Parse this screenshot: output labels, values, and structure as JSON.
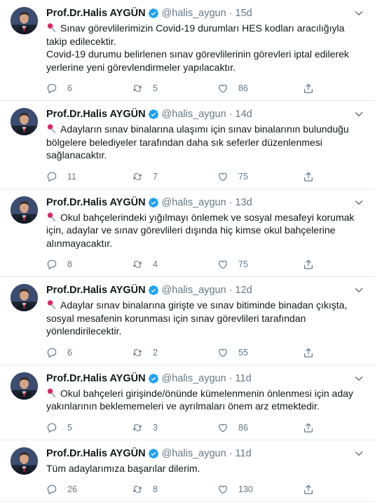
{
  "author": {
    "name": "Prof.Dr.Halis AYGÜN",
    "handle": "@halis_aygun"
  },
  "colors": {
    "text": "#14171a",
    "muted": "#657786",
    "verified": "#1da1f2",
    "divider": "#e6ecf0"
  },
  "tweets": [
    {
      "time": "15d",
      "pinned": true,
      "lines": [
        "Sınav görevlilerimizin Covid-19 durumları HES kodları aracılığıyla takip edilecektir.",
        "Covid-19 durumu belirlenen sınav görevlilerinin görevleri iptal edilerek yerlerine yeni görevlendirmeler yapılacaktır."
      ],
      "replies": "6",
      "retweets": "5",
      "likes": "86"
    },
    {
      "time": "14d",
      "pinned": true,
      "lines": [
        "Adayların sınav binalarına ulaşımı için sınav binalarının bulunduğu bölgelere belediyeler tarafından daha sık seferler düzenlenmesi sağlanacaktır."
      ],
      "replies": "11",
      "retweets": "7",
      "likes": "75"
    },
    {
      "time": "13d",
      "pinned": true,
      "lines": [
        "Okul bahçelerindeki yığılmayı önlemek ve sosyal mesafeyi korumak için, adaylar ve sınav görevlileri dışında hiç kimse okul bahçelerine alınmayacaktır."
      ],
      "replies": "8",
      "retweets": "4",
      "likes": "75"
    },
    {
      "time": "12d",
      "pinned": true,
      "lines": [
        "Adaylar sınav binalarına girişte ve sınav bitiminde binadan çıkışta, sosyal mesafenin korunması için sınav görevlileri tarafından yönlendirilecektir."
      ],
      "replies": "6",
      "retweets": "2",
      "likes": "55"
    },
    {
      "time": "11d",
      "pinned": true,
      "lines": [
        "Okul bahçeleri girişinde/önünde kümelenmenin önlenmesi için aday yakınlarının beklememeleri ve ayrılmaları önem arz etmektedir."
      ],
      "replies": "5",
      "retweets": "3",
      "likes": "86"
    },
    {
      "time": "11d",
      "pinned": false,
      "lines": [
        "Tüm adaylarımıza başarılar dilerim."
      ],
      "replies": "26",
      "retweets": "8",
      "likes": "130"
    }
  ]
}
